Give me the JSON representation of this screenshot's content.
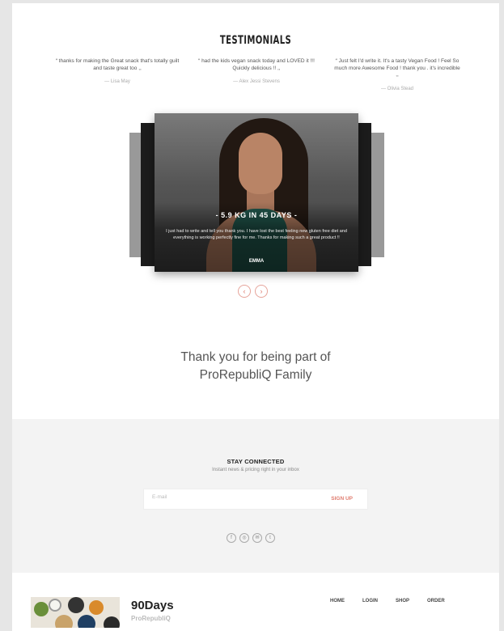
{
  "testimonials": {
    "title": "TESTIMONIALS",
    "quotes": [
      {
        "text": "“ thanks for making the Great snack that's totally guilt and taste great too ,,",
        "author": "— Lisa May"
      },
      {
        "text": "“ had the kids vegan snack today and LOVED it !!! Quickly delicious !! ,,",
        "author": "— Alex Jessi Stevens"
      },
      {
        "text": "“ Just felt I'd write it. It's a tasty Vegan Food ! Feel So much more Awesome Food ! thank you . it's incredible ,,",
        "author": "— Olivia Stead"
      }
    ]
  },
  "slider": {
    "heading": "- 5.9 KG IN 45 DAYS -",
    "text": "I just had to write and tell you thank you. I have lost the best feeling new gluten free diet and everything is working perfectly fine for me. Thanks for making such a great product !!",
    "author": "EMMA",
    "prev": "‹",
    "next": "›"
  },
  "thanks": {
    "line1": "Thank you for being part of",
    "line2": "ProRepubliQ Family"
  },
  "newsletter": {
    "title": "STAY CONNECTED",
    "subtitle": "Instant news & pricing right in your inbox",
    "placeholder": "E-mail",
    "button": "SIGN UP"
  },
  "socials": [
    {
      "icon": "facebook-icon",
      "glyph": "f"
    },
    {
      "icon": "instagram-icon",
      "glyph": "◎"
    },
    {
      "icon": "mail-icon",
      "glyph": "✉"
    },
    {
      "icon": "twitter-icon",
      "glyph": "t"
    }
  ],
  "footer": {
    "brand": "90Days",
    "sub": "ProRepubliQ",
    "nav": [
      "HOME",
      "LOGIN",
      "SHOP",
      "ORDER"
    ]
  }
}
